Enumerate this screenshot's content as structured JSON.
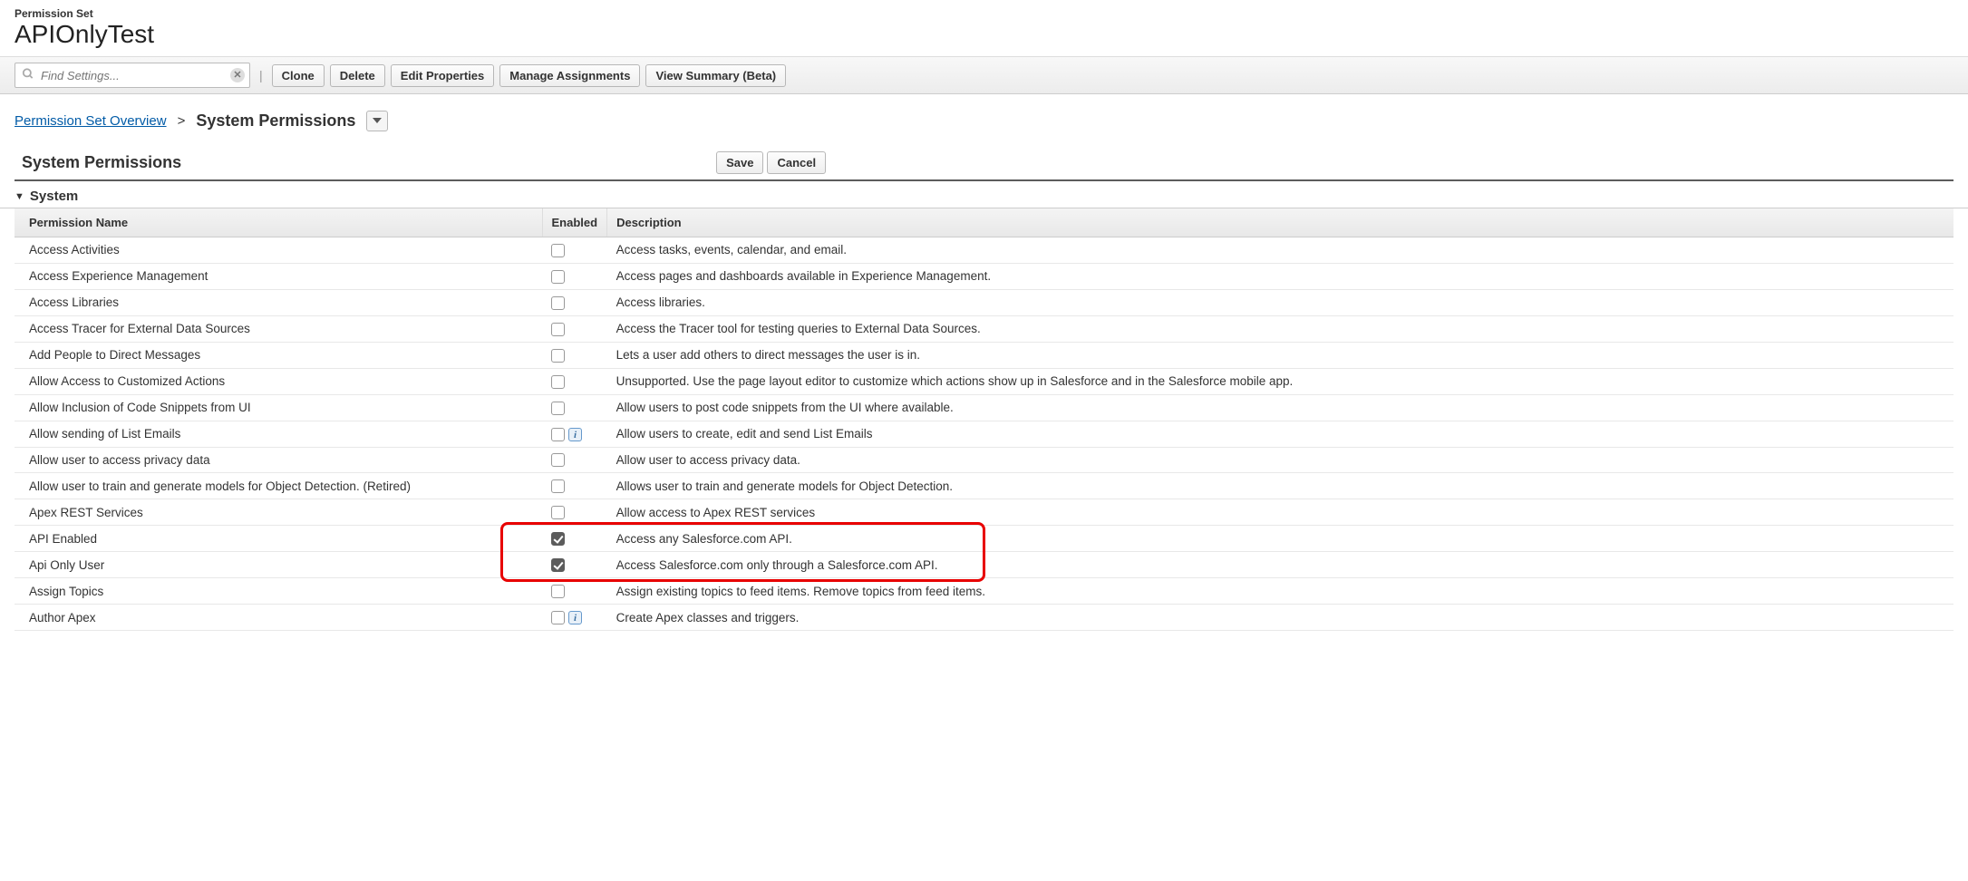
{
  "header": {
    "page_type": "Permission Set",
    "page_title": "APIOnlyTest"
  },
  "search": {
    "placeholder": "Find Settings..."
  },
  "toolbar": {
    "clone": "Clone",
    "delete": "Delete",
    "edit_properties": "Edit Properties",
    "manage_assignments": "Manage Assignments",
    "view_summary": "View Summary (Beta)"
  },
  "breadcrumb": {
    "overview": "Permission Set Overview",
    "sep": ">",
    "current": "System Permissions"
  },
  "section": {
    "title": "System Permissions",
    "save": "Save",
    "cancel": "Cancel",
    "group": "System"
  },
  "columns": {
    "name": "Permission Name",
    "enabled": "Enabled",
    "description": "Description"
  },
  "permissions": [
    {
      "name": "Access Activities",
      "enabled": false,
      "info": false,
      "highlighted": false,
      "description": "Access tasks, events, calendar, and email."
    },
    {
      "name": "Access Experience Management",
      "enabled": false,
      "info": false,
      "highlighted": false,
      "description": "Access pages and dashboards available in Experience Management."
    },
    {
      "name": "Access Libraries",
      "enabled": false,
      "info": false,
      "highlighted": false,
      "description": "Access libraries."
    },
    {
      "name": "Access Tracer for External Data Sources",
      "enabled": false,
      "info": false,
      "highlighted": false,
      "description": "Access the Tracer tool for testing queries to External Data Sources."
    },
    {
      "name": "Add People to Direct Messages",
      "enabled": false,
      "info": false,
      "highlighted": false,
      "description": "Lets a user add others to direct messages the user is in."
    },
    {
      "name": "Allow Access to Customized Actions",
      "enabled": false,
      "info": false,
      "highlighted": false,
      "description": "Unsupported. Use the page layout editor to customize which actions show up in Salesforce and in the Salesforce mobile app."
    },
    {
      "name": "Allow Inclusion of Code Snippets from UI",
      "enabled": false,
      "info": false,
      "highlighted": false,
      "description": "Allow users to post code snippets from the UI where available."
    },
    {
      "name": "Allow sending of List Emails",
      "enabled": false,
      "info": true,
      "highlighted": false,
      "description": "Allow users to create, edit and send List Emails"
    },
    {
      "name": "Allow user to access privacy data",
      "enabled": false,
      "info": false,
      "highlighted": false,
      "description": "Allow user to access privacy data."
    },
    {
      "name": "Allow user to train and generate models for Object Detection. (Retired)",
      "enabled": false,
      "info": false,
      "highlighted": false,
      "description": "Allows user to train and generate models for Object Detection."
    },
    {
      "name": "Apex REST Services",
      "enabled": false,
      "info": false,
      "highlighted": false,
      "description": "Allow access to Apex REST services"
    },
    {
      "name": "API Enabled",
      "enabled": true,
      "info": false,
      "highlighted": true,
      "description": "Access any Salesforce.com API."
    },
    {
      "name": "Api Only User",
      "enabled": true,
      "info": false,
      "highlighted": true,
      "description": "Access Salesforce.com only through a Salesforce.com API."
    },
    {
      "name": "Assign Topics",
      "enabled": false,
      "info": false,
      "highlighted": false,
      "description": "Assign existing topics to feed items. Remove topics from feed items."
    },
    {
      "name": "Author Apex",
      "enabled": false,
      "info": true,
      "highlighted": false,
      "description": "Create Apex classes and triggers."
    }
  ]
}
